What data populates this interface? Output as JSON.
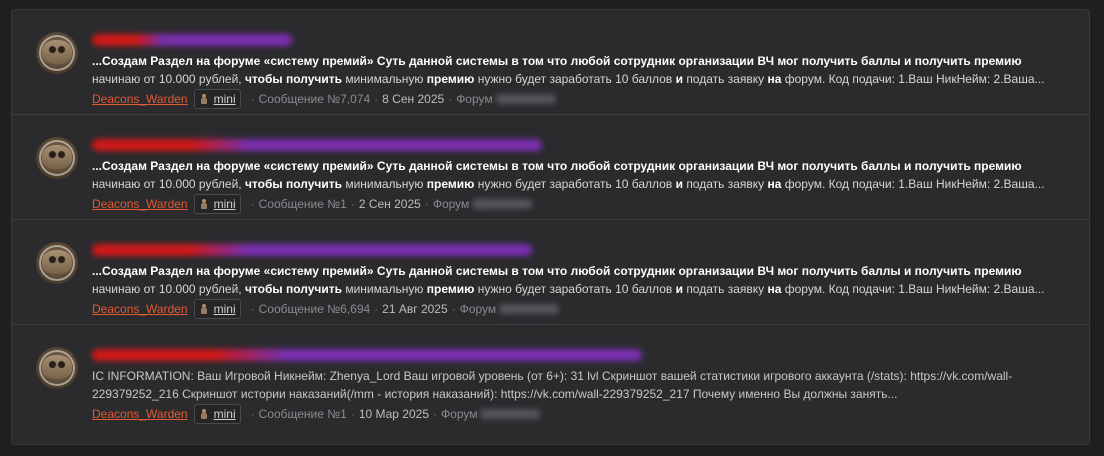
{
  "results": [
    {
      "title_colors": [
        "#d01818",
        "#7a2fb0"
      ],
      "title_width": 200,
      "snippet_html_parts": [
        {
          "t": "...Создам Раздел на форуме «систему премий» Суть данной системы в том что любой сотрудник организации ВЧ мог получить баллы и получить премию ",
          "b": true
        },
        {
          "t": "начинаю от 10.000 рублей, ",
          "b": false
        },
        {
          "t": "чтобы ",
          "b": true
        },
        {
          "t": "получить ",
          "b": true
        },
        {
          "t": "минимальную ",
          "b": false
        },
        {
          "t": "премию ",
          "b": true
        },
        {
          "t": "нужно будет заработать 10 баллов ",
          "b": false
        },
        {
          "t": "и ",
          "b": true
        },
        {
          "t": "подать заявку ",
          "b": false
        },
        {
          "t": "на ",
          "b": true
        },
        {
          "t": "форум. Код подачи: 1.Ваш НикНейм: 2.Ваша...",
          "b": false
        }
      ],
      "author": "Deacons_Warden",
      "badge": "mini",
      "post_label": "Сообщение №7,074",
      "date": "8 Сен 2025",
      "forum_label": "Форум"
    },
    {
      "title_colors": [
        "#d01818",
        "#7a2fb0"
      ],
      "title_width": 450,
      "snippet_html_parts": [
        {
          "t": "...Создам Раздел на форуме «систему премий» Суть данной системы в том что любой сотрудник организации ВЧ мог получить баллы и получить премию ",
          "b": true
        },
        {
          "t": "начинаю от 10.000 рублей, ",
          "b": false
        },
        {
          "t": "чтобы ",
          "b": true
        },
        {
          "t": "получить ",
          "b": true
        },
        {
          "t": "минимальную ",
          "b": false
        },
        {
          "t": "премию ",
          "b": true
        },
        {
          "t": "нужно будет заработать 10 баллов ",
          "b": false
        },
        {
          "t": "и ",
          "b": true
        },
        {
          "t": "подать заявку ",
          "b": false
        },
        {
          "t": "на ",
          "b": true
        },
        {
          "t": "форум. Код подачи: 1.Ваш НикНейм: 2.Ваша...",
          "b": false
        }
      ],
      "author": "Deacons_Warden",
      "badge": "mini",
      "post_label": "Сообщение №1",
      "date": "2 Сен 2025",
      "forum_label": "Форум"
    },
    {
      "title_colors": [
        "#d01818",
        "#7a2fb0"
      ],
      "title_width": 440,
      "snippet_html_parts": [
        {
          "t": "...Создам Раздел на форуме «систему премий» Суть данной системы в том что любой сотрудник организации ВЧ мог получить баллы и получить премию ",
          "b": true
        },
        {
          "t": "начинаю от 10.000 рублей, ",
          "b": false
        },
        {
          "t": "чтобы ",
          "b": true
        },
        {
          "t": "получить ",
          "b": true
        },
        {
          "t": "минимальную ",
          "b": false
        },
        {
          "t": "премию ",
          "b": true
        },
        {
          "t": "нужно будет заработать 10 баллов ",
          "b": false
        },
        {
          "t": "и ",
          "b": true
        },
        {
          "t": "подать заявку ",
          "b": false
        },
        {
          "t": "на ",
          "b": true
        },
        {
          "t": "форум. Код подачи: 1.Ваш НикНейм: 2.Ваша...",
          "b": false
        }
      ],
      "author": "Deacons_Warden",
      "badge": "mini",
      "post_label": "Сообщение №6,694",
      "date": "21 Авг 2025",
      "forum_label": "Форум"
    },
    {
      "title_colors": [
        "#d01818",
        "#7a2fb0"
      ],
      "title_width": 550,
      "snippet_html_parts": [
        {
          "t": "IC INFORMATION: Ваш Игровой Никнейм: Zhenya_Lord Ваш игровой уровень (от 6+): 31 lvl Скриншот вашей статистики игрового аккаунта (/stats): https://vk.com/wall-229379252_216 Скриншот истории наказаний(/mm - история наказаний): https://vk.com/wall-229379252_217 Почему именно Вы должны занять...",
          "b": false
        }
      ],
      "author": "Deacons_Warden",
      "badge": "mini",
      "post_label": "Сообщение №1",
      "date": "10 Мар 2025",
      "forum_label": "Форум"
    }
  ]
}
